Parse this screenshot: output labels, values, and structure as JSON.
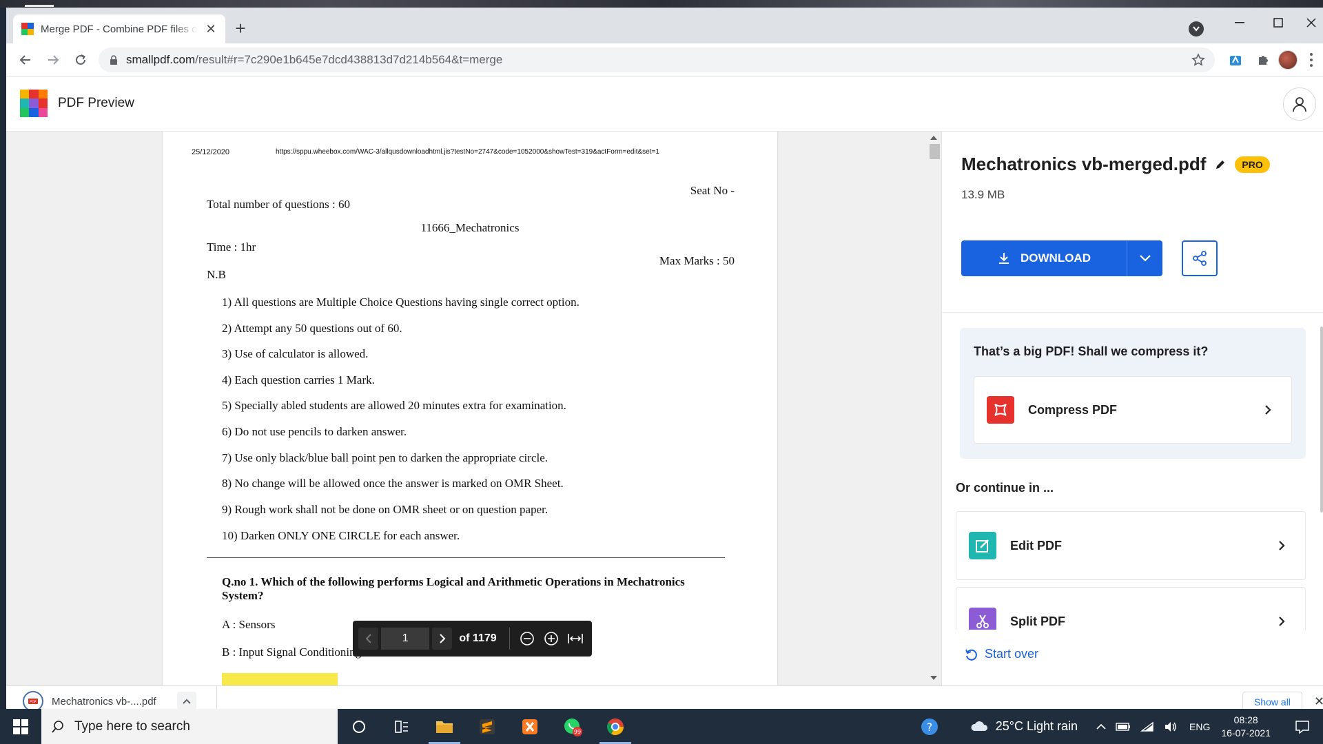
{
  "browser": {
    "tab_title": "Merge PDF - Combine PDF files online",
    "url_host": "smallpdf.com",
    "url_path": "/result#r=7c290e1b645e7dcd438813d7d214b564&t=merge"
  },
  "app": {
    "title": "PDF Preview"
  },
  "document": {
    "header_date": "25/12/2020",
    "header_url": "https://sppu.wheebox.com/WAC-3/allqusdownloadhtml.jis?testNo=2747&code=1052000&showTest=319&actForm=edit&set=1",
    "seat_no": "Seat No -",
    "total_questions": "Total number of questions : 60",
    "course": "11666_Mechatronics",
    "time": "Time : 1hr",
    "max_marks": "Max Marks : 50",
    "nb": "N.B",
    "instructions": [
      "1) All questions are Multiple Choice Questions having single correct option.",
      "2) Attempt any 50 questions out of 60.",
      "3) Use of calculator is allowed.",
      "4) Each question carries 1 Mark.",
      "5) Specially abled students are allowed 20 minutes extra for examination.",
      "6) Do not use pencils to darken answer.",
      "7) Use only black/blue ball point pen to darken the appropriate circle.",
      "8) No change will be allowed once the answer is marked on OMR Sheet.",
      "9) Rough work shall not be done on OMR sheet or on question paper.",
      "10) Darken ONLY ONE CIRCLE for each answer."
    ],
    "question": "Q.no 1. Which of the following performs Logical and Arithmetic Operations in Mechatronics System?",
    "option_a": "A : Sensors",
    "option_b": "B : Input Signal Conditioning"
  },
  "pager": {
    "current_page": "1",
    "of_total": "of 1179"
  },
  "side_panel": {
    "file_name": "Mechatronics vb-merged.pdf",
    "pro_badge": "PRO",
    "file_size": "13.9 MB",
    "download_label": "DOWNLOAD",
    "compress_question": "That’s a big PDF! Shall we compress it?",
    "compress_label": "Compress PDF",
    "continue_heading": "Or continue in ...",
    "edit_label": "Edit PDF",
    "split_label": "Split PDF",
    "start_over": "Start over"
  },
  "downloads": {
    "file_name": "Mechatronics vb-....pdf",
    "show_all": "Show all"
  },
  "taskbar": {
    "search_placeholder": "Type here to search",
    "whatsapp_badge": "99",
    "weather": "25°C  Light rain",
    "language": "ENG",
    "time": "08:28",
    "date": "16-07-2021"
  },
  "colors": {
    "accent": "#1a63e0",
    "pro": "#ffc107",
    "compress": "#e5322d",
    "edit": "#1fb7b0",
    "split": "#8c5bd6"
  }
}
